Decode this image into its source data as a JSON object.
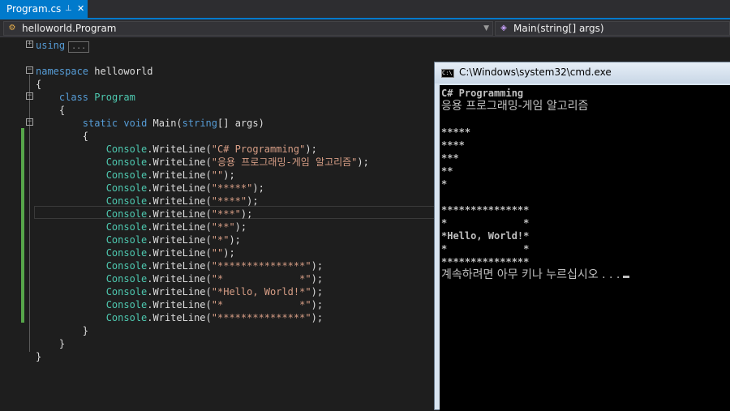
{
  "tab": {
    "title": "Program.cs",
    "pin_icon": "pin-icon",
    "close_icon": "close-icon"
  },
  "navbar": {
    "class_combo": "helloworld.Program",
    "member_combo": "Main(string[] args)"
  },
  "code": {
    "using_kw": "using",
    "using_collapsed": "...",
    "namespace_kw": "namespace",
    "namespace_name": "helloworld",
    "open_brace": "{",
    "close_brace": "}",
    "class_kw": "class",
    "class_name": "Program",
    "static_kw": "static",
    "void_kw": "void",
    "main_name": "Main(",
    "string_kw": "string",
    "main_rest": "[] args)",
    "console": "Console",
    "writeline": ".WriteLine(",
    "end_call": ");",
    "strings": [
      "\"C# Programming\"",
      "\"응용 프로그래밍-게임 알고리즘\"",
      "\"\"",
      "\"*****\"",
      "\"****\"",
      "\"***\"",
      "\"**\"",
      "\"*\"",
      "\"\"",
      "\"***************\"",
      "\"*             *\"",
      "\"*Hello, World!*\"",
      "\"*             *\"",
      "\"***************\""
    ]
  },
  "console": {
    "title": "C:\\Windows\\system32\\cmd.exe",
    "lines": [
      "C# Programming",
      "응용 프로그래밍-게임 알고리즘",
      "",
      "*****",
      "****",
      "***",
      "**",
      "*",
      "",
      "***************",
      "*             *",
      "*Hello, World!*",
      "*             *",
      "***************",
      "계속하려면 아무 키나 누르십시오 . . ."
    ]
  }
}
